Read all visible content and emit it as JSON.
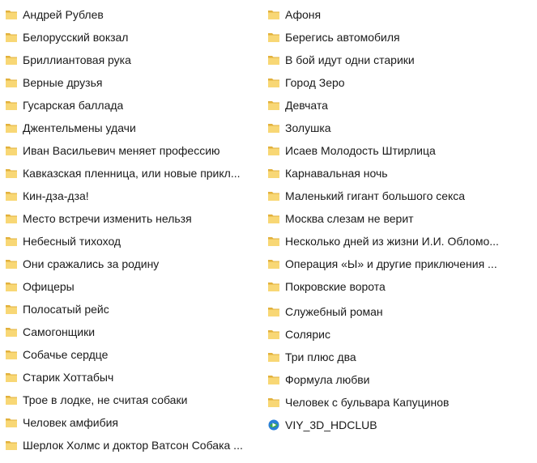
{
  "left_column": [
    {
      "name": "Андрей Рублев",
      "icon": "folder-icon"
    },
    {
      "name": "Белорусский вокзал",
      "icon": "folder-icon"
    },
    {
      "name": "Бриллиантовая рука",
      "icon": "folder-icon"
    },
    {
      "name": "Верные друзья",
      "icon": "folder-icon"
    },
    {
      "name": "Гусарская баллада",
      "icon": "folder-icon"
    },
    {
      "name": "Джентельмены удачи",
      "icon": "folder-icon"
    },
    {
      "name": "Иван Васильевич меняет профессию",
      "icon": "folder-icon"
    },
    {
      "name": "Кавказская пленница, или новые прикл...",
      "icon": "folder-icon"
    },
    {
      "name": "Кин-дза-дза!",
      "icon": "folder-icon"
    },
    {
      "name": "Место встречи изменить нельзя",
      "icon": "folder-icon"
    },
    {
      "name": "Небесный тихоход",
      "icon": "folder-icon"
    },
    {
      "name": "Они сражались за родину",
      "icon": "folder-icon"
    },
    {
      "name": "Офицеры",
      "icon": "folder-icon"
    },
    {
      "name": "Полосатый рейс",
      "icon": "folder-icon"
    },
    {
      "name": "Самогонщики",
      "icon": "folder-icon"
    },
    {
      "name": "Собачье сердце",
      "icon": "folder-icon"
    },
    {
      "name": "Старик Хоттабыч",
      "icon": "folder-icon"
    },
    {
      "name": "Трое в лодке, не считая собаки",
      "icon": "folder-icon"
    },
    {
      "name": "Человек амфибия",
      "icon": "folder-icon"
    },
    {
      "name": "Шерлок Холмс и доктор Ватсон Собака ...",
      "icon": "folder-icon"
    }
  ],
  "right_column": [
    {
      "name": "Афоня",
      "icon": "folder-icon"
    },
    {
      "name": "Берегись автомобиля",
      "icon": "folder-icon"
    },
    {
      "name": "В бой идут одни старики",
      "icon": "folder-icon"
    },
    {
      "name": "Город Зеро",
      "icon": "folder-icon"
    },
    {
      "name": "Девчата",
      "icon": "folder-icon"
    },
    {
      "name": "Золушка",
      "icon": "folder-icon"
    },
    {
      "name": "Исаев Молодость Штирлица",
      "icon": "folder-icon"
    },
    {
      "name": "Карнавальная ночь",
      "icon": "folder-icon"
    },
    {
      "name": "Маленький гигант большого секса",
      "icon": "folder-icon"
    },
    {
      "name": "Москва слезам не верит",
      "icon": "folder-icon"
    },
    {
      "name": "Несколько дней из жизни И.И. Обломо...",
      "icon": "folder-icon"
    },
    {
      "name": "Операция «Ы» и другие приключения ...",
      "icon": "folder-icon"
    },
    {
      "name": "Покровские ворота",
      "icon": "folder-icon"
    },
    {
      "name": "Служебный роман",
      "icon": "folder-icon"
    },
    {
      "name": "Солярис",
      "icon": "folder-icon"
    },
    {
      "name": "Три плюс два",
      "icon": "folder-icon"
    },
    {
      "name": "Формула любви",
      "icon": "folder-icon"
    },
    {
      "name": "Человек с бульвара Капуцинов",
      "icon": "folder-icon"
    },
    {
      "name": "VIY_3D_HDCLUB",
      "icon": "video-file-icon"
    }
  ],
  "colors": {
    "folder_back": "#e2b13c",
    "folder_front": "#f8d775",
    "file_blue": "#2a7fd8",
    "file_green": "#3da84a",
    "text": "#1a1a1a"
  }
}
